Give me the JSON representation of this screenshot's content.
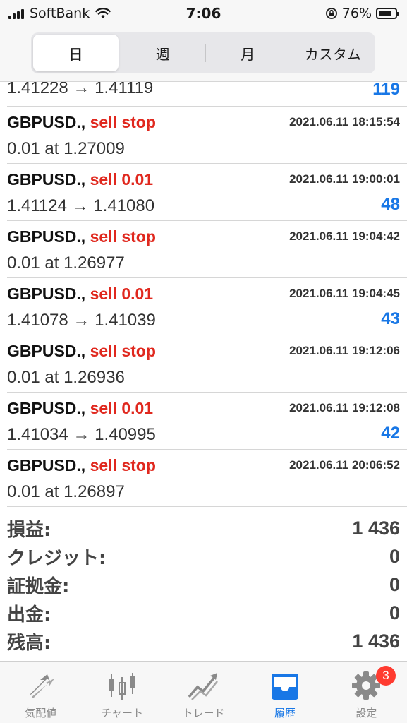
{
  "status_bar": {
    "carrier": "SoftBank",
    "time": "7:06",
    "battery_percent": "76%",
    "battery_level": 0.76
  },
  "segments": [
    {
      "label": "日",
      "active": true
    },
    {
      "label": "週",
      "active": false
    },
    {
      "label": "月",
      "active": false
    },
    {
      "label": "カスタム",
      "active": false
    }
  ],
  "partial_row": {
    "detail": "1.41228 → 1.41119",
    "profit": "119"
  },
  "rows": [
    {
      "symbol": "GBPUSD.,",
      "action": "sell stop",
      "time": "2021.06.11 18:15:54",
      "detail": "0.01 at 1.27009",
      "profit": ""
    },
    {
      "symbol": "GBPUSD.,",
      "action": "sell 0.01",
      "time": "2021.06.11 19:00:01",
      "detail": "1.41124 → 1.41080",
      "profit": "48"
    },
    {
      "symbol": "GBPUSD.,",
      "action": "sell stop",
      "time": "2021.06.11 19:04:42",
      "detail": "0.01 at 1.26977",
      "profit": ""
    },
    {
      "symbol": "GBPUSD.,",
      "action": "sell 0.01",
      "time": "2021.06.11 19:04:45",
      "detail": "1.41078 → 1.41039",
      "profit": "43"
    },
    {
      "symbol": "GBPUSD.,",
      "action": "sell stop",
      "time": "2021.06.11 19:12:06",
      "detail": "0.01 at 1.26936",
      "profit": ""
    },
    {
      "symbol": "GBPUSD.,",
      "action": "sell 0.01",
      "time": "2021.06.11 19:12:08",
      "detail": "1.41034 → 1.40995",
      "profit": "42"
    },
    {
      "symbol": "GBPUSD.,",
      "action": "sell stop",
      "time": "2021.06.11 20:06:52",
      "detail": "0.01 at 1.26897",
      "profit": ""
    }
  ],
  "summary": [
    {
      "label": "損益:",
      "value": "1 436"
    },
    {
      "label": "クレジット:",
      "value": "0"
    },
    {
      "label": "証拠金:",
      "value": "0"
    },
    {
      "label": "出金:",
      "value": "0"
    },
    {
      "label": "残高:",
      "value": "1 436"
    }
  ],
  "tabbar": {
    "items": [
      {
        "label": "気配値",
        "icon": "quotes-arrows-icon"
      },
      {
        "label": "チャート",
        "icon": "candlestick-chart-icon"
      },
      {
        "label": "トレード",
        "icon": "trade-chart-icon"
      },
      {
        "label": "履歴",
        "icon": "history-inbox-icon"
      },
      {
        "label": "設定",
        "icon": "gear-icon"
      }
    ],
    "active_index": 3,
    "settings_badge": "3"
  },
  "colors": {
    "accent_blue": "#1877e6",
    "sell_red": "#e0281e",
    "badge_red": "#ff3b30"
  }
}
